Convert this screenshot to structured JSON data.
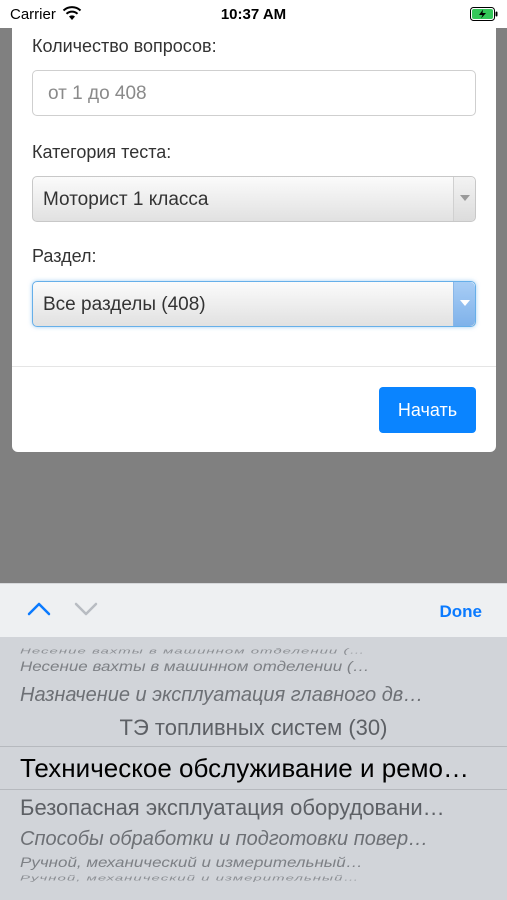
{
  "status_bar": {
    "carrier": "Carrier",
    "time": "10:37 AM"
  },
  "form": {
    "questions_label": "Количество вопросов:",
    "questions_placeholder": "от 1 до 408",
    "category_label": "Категория теста:",
    "category_value": "Моторист 1 класса",
    "section_label": "Раздел:",
    "section_value": "Все разделы (408)",
    "start_button": "Начать"
  },
  "toolbar": {
    "done_label": "Done"
  },
  "picker": {
    "items": [
      "Несение вахты в машинном отделении (…",
      "Назначение и эксплуатация главного дв…",
      "ТЭ топливных систем (30)",
      "Техническое обслуживание и ремо…",
      "Безопасная эксплуатация оборудовани…",
      "Способы обработки и подготовки повер…",
      "Ручной, механический и измерительный…"
    ],
    "selected_index": 3
  },
  "colors": {
    "accent": "#0a84ff",
    "overlay": "#808080",
    "picker_bg": "#d1d4d9"
  }
}
